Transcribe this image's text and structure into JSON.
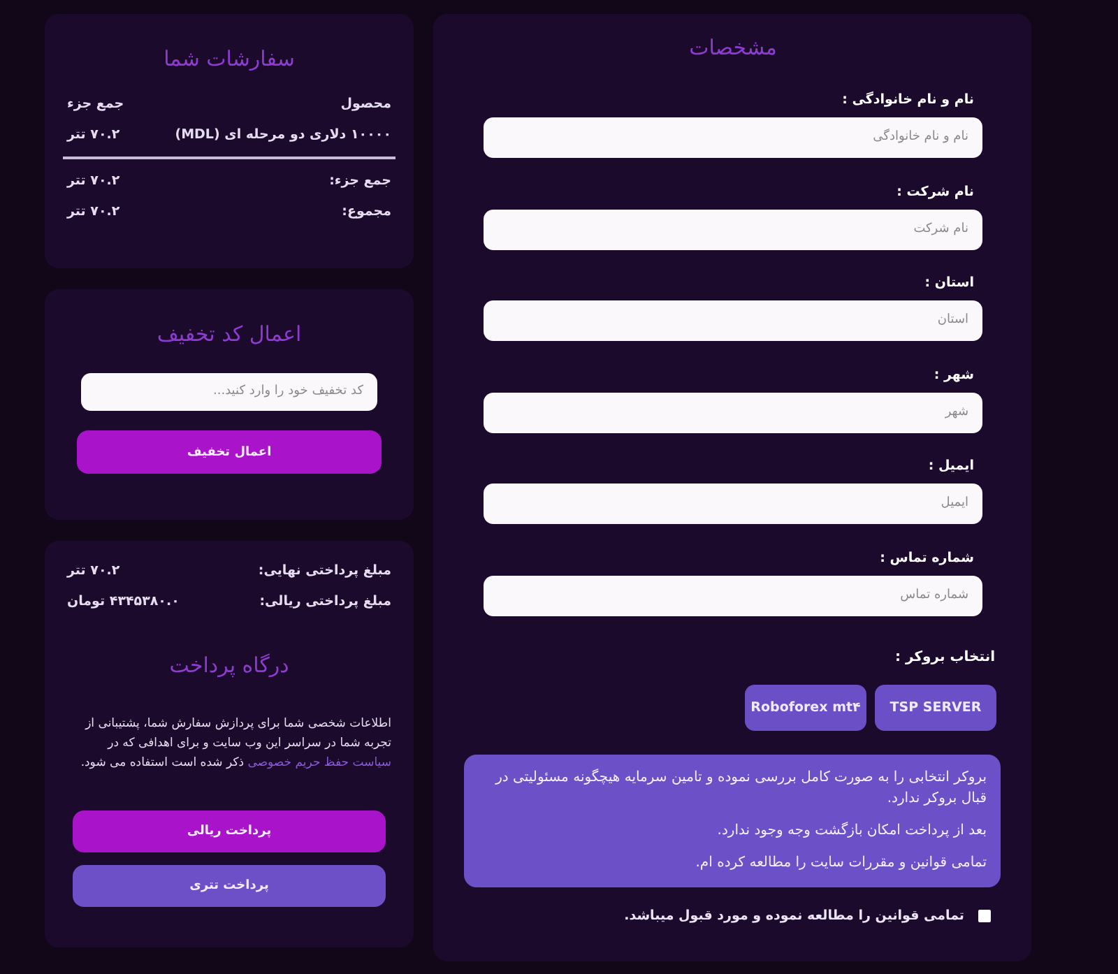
{
  "order_summary": {
    "title": "سفارشات شما",
    "columns": [
      "محصول",
      "جمع جزء"
    ],
    "rows": [
      {
        "product": "۱۰۰۰۰ دلاری دو مرحله ای (MDL)",
        "subtotal": "۷۰.۲ تتر"
      }
    ],
    "totals": [
      {
        "label": "جمع جزء:",
        "value": "۷۰.۲ تتر"
      },
      {
        "label": "مجموع:",
        "value": "۷۰.۲ تتر"
      }
    ]
  },
  "coupon": {
    "title": "اعمال کد تخفیف",
    "placeholder": "کد تخفیف خود را وارد کنید...",
    "button": "اعمال تخفیف"
  },
  "payment": {
    "amounts": [
      {
        "label": "مبلغ پرداختی نهایی:",
        "value": "۷۰.۲ تتر"
      },
      {
        "label": "مبلغ پرداختی ریالی:",
        "value": "۴۳۴۵۳۸۰.۰ تومان"
      }
    ],
    "title": "درگاه پرداخت",
    "privacy_notice": {
      "before": "اطلاعات شخصی شما برای پردازش سفارش شما، پشتیبانی از تجربه شما در سراسر این وب سایت و برای اهدافی که در",
      "link": "سیاست حفظ حریم خصوصی",
      "after": "ذکر شده است استفاده می شود."
    },
    "buttons": [
      {
        "label": "پرداخت ریالی",
        "kind": "primary"
      },
      {
        "label": "پرداخت تتری",
        "kind": "secondary"
      }
    ]
  },
  "details": {
    "title": "مشخصات",
    "fields": [
      {
        "label": "نام و نام خانوادگی :",
        "placeholder": "نام و نام خانوادگی"
      },
      {
        "label": "نام شرکت :",
        "placeholder": "نام شرکت"
      },
      {
        "label": "استان :",
        "placeholder": "استان"
      },
      {
        "label": "شهر :",
        "placeholder": "شهر"
      },
      {
        "label": "ایمیل :",
        "placeholder": "ایمیل"
      },
      {
        "label": "شماره تماس :",
        "placeholder": "شماره تماس"
      }
    ],
    "broker": {
      "label": "انتخاب بروکر :",
      "options": [
        {
          "label": "TSP SERVER",
          "selected": false
        },
        {
          "label": "Roboforex mt۴",
          "selected": false
        }
      ]
    },
    "notice": [
      "بروکر انتخابی را به صورت کامل بررسی نموده و تامین سرمایه هیچگونه مسئولیتی در قبال بروکر ندارد.",
      "بعد از پرداخت امکان بازگشت وجه وجود ندارد.",
      "تمامی قوانین و مقررات سایت را مطالعه کرده ام."
    ],
    "terms": {
      "label": "تمامی قوانین را مطالعه نموده و مورد قبول میباشد.",
      "checked": false
    }
  }
}
